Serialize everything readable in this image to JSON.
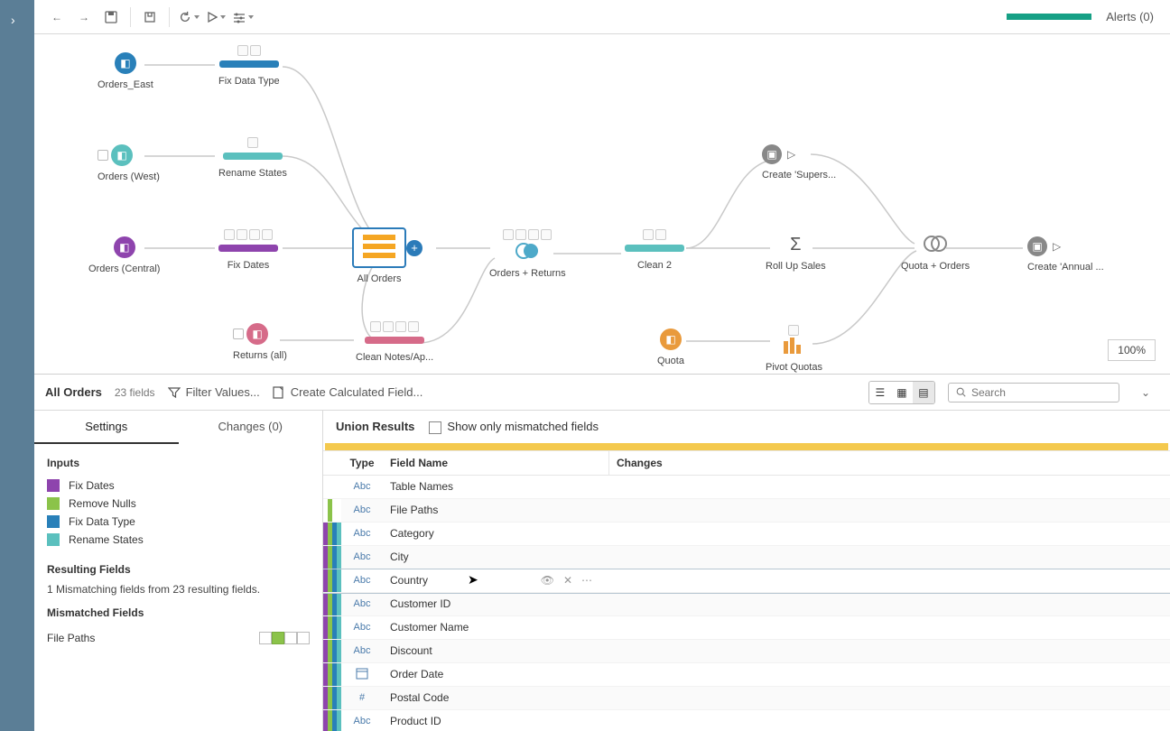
{
  "toolbar": {
    "alerts": "Alerts (0)"
  },
  "zoom": "100%",
  "nodes": {
    "orders_east": "Orders_East",
    "fix_data_type": "Fix Data Type",
    "orders_west": "Orders (West)",
    "rename_states": "Rename States",
    "orders_central": "Orders (Central)",
    "fix_dates": "Fix Dates",
    "all_orders": "All Orders",
    "orders_returns": "Orders + Returns",
    "clean2": "Clean 2",
    "rollup": "Roll Up Sales",
    "quota_orders": "Quota + Orders",
    "create_annual": "Create 'Annual ...",
    "returns_all": "Returns (all)",
    "clean_notes": "Clean Notes/Ap...",
    "quota": "Quota",
    "pivot_quotas": "Pivot Quotas",
    "create_supers": "Create 'Supers..."
  },
  "colors": {
    "purple": "#8e44ad",
    "teal": "#5bc0be",
    "blue": "#2980b9",
    "green": "#8bc34a",
    "pink": "#d66b89",
    "orange": "#e99a3c",
    "gray": "#888"
  },
  "detail": {
    "title": "All Orders",
    "meta": "23 fields",
    "filter": "Filter Values...",
    "calc": "Create Calculated Field...",
    "search_ph": "Search",
    "tabs": {
      "settings": "Settings",
      "changes": "Changes (0)"
    },
    "inputs_h": "Inputs",
    "inputs": [
      {
        "label": "Fix Dates",
        "color": "#8e44ad"
      },
      {
        "label": "Remove Nulls",
        "color": "#8bc34a"
      },
      {
        "label": "Fix Data Type",
        "color": "#2980b9"
      },
      {
        "label": "Rename States",
        "color": "#5bc0be"
      }
    ],
    "resulting_h": "Resulting Fields",
    "resulting_txt": "1 Mismatching fields from 23 resulting fields.",
    "mismatched_h": "Mismatched Fields",
    "mismatched_item": "File Paths",
    "union_title": "Union Results",
    "show_mismatch": "Show only mismatched fields",
    "head_type": "Type",
    "head_name": "Field Name",
    "head_changes": "Changes",
    "rows": [
      {
        "type": "Abc",
        "name": "Table Names",
        "stripes": [
          "#fff",
          "#fff",
          "#fff",
          "#fff"
        ]
      },
      {
        "type": "Abc",
        "name": "File Paths",
        "stripes": [
          "#fff",
          "#8bc34a",
          "#fff",
          "#fff"
        ]
      },
      {
        "type": "Abc",
        "name": "Category",
        "stripes": [
          "#8e44ad",
          "#8bc34a",
          "#2980b9",
          "#5bc0be"
        ]
      },
      {
        "type": "Abc",
        "name": "City",
        "stripes": [
          "#8e44ad",
          "#8bc34a",
          "#2980b9",
          "#5bc0be"
        ]
      },
      {
        "type": "Abc",
        "name": "Country",
        "stripes": [
          "#8e44ad",
          "#8bc34a",
          "#2980b9",
          "#5bc0be"
        ],
        "hovered": true
      },
      {
        "type": "Abc",
        "name": "Customer ID",
        "stripes": [
          "#8e44ad",
          "#8bc34a",
          "#2980b9",
          "#5bc0be"
        ]
      },
      {
        "type": "Abc",
        "name": "Customer Name",
        "stripes": [
          "#8e44ad",
          "#8bc34a",
          "#2980b9",
          "#5bc0be"
        ]
      },
      {
        "type": "Abc",
        "name": "Discount",
        "stripes": [
          "#8e44ad",
          "#8bc34a",
          "#2980b9",
          "#5bc0be"
        ]
      },
      {
        "type": "date",
        "name": "Order Date",
        "stripes": [
          "#8e44ad",
          "#8bc34a",
          "#2980b9",
          "#5bc0be"
        ]
      },
      {
        "type": "#",
        "name": "Postal Code",
        "stripes": [
          "#8e44ad",
          "#8bc34a",
          "#2980b9",
          "#5bc0be"
        ]
      },
      {
        "type": "Abc",
        "name": "Product ID",
        "stripes": [
          "#8e44ad",
          "#8bc34a",
          "#2980b9",
          "#5bc0be"
        ]
      }
    ]
  }
}
